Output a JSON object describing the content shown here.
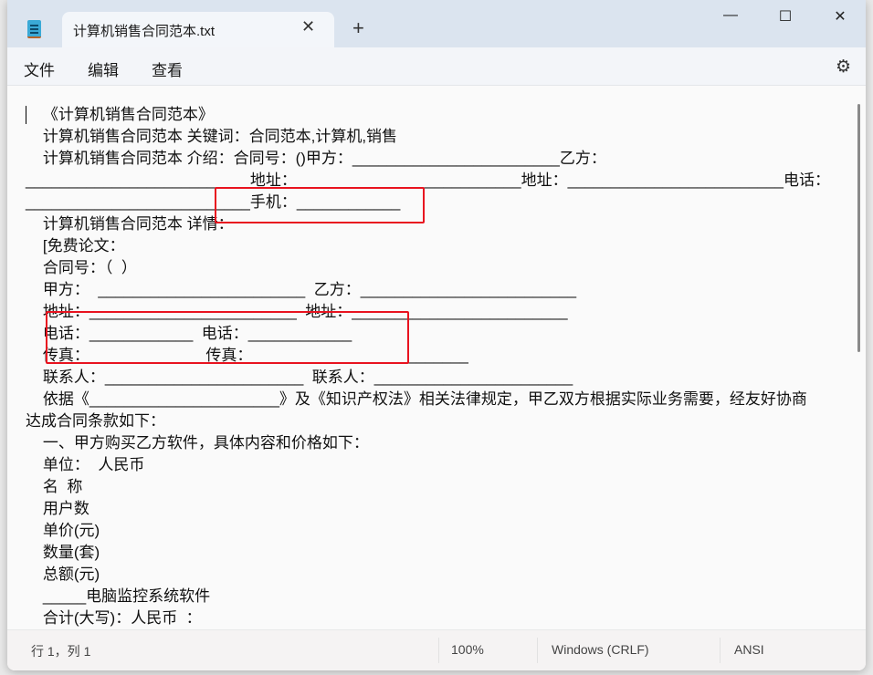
{
  "window": {
    "tab_title": "计算机销售合同范本.txt",
    "tab_close": "✕",
    "new_tab": "+",
    "minimize": "—",
    "maximize": "☐",
    "close": "✕"
  },
  "menu": {
    "items": [
      "文件",
      "编辑",
      "查看"
    ],
    "settings_icon": "⚙"
  },
  "editor": {
    "lines": [
      "    《计算机销售合同范本》",
      "    计算机销售合同范本 关键词：合同范本,计算机,销售",
      "    计算机销售合同范本 介绍：合同号：()甲方：________________________乙方：",
      "__________________________地址：__________________________地址：_________________________电话：",
      "__________________________手机：____________",
      "    计算机销售合同范本 详情：",
      "    [免费论文：",
      "    合同号：（  ）",
      "    甲方：  ________________________  乙方：_________________________",
      "    地址：________________________  地址：_________________________",
      "    电话：____________  电话：____________",
      "    传真：                           传真：_________________________",
      "    联系人：_______________________  联系人：_______________________",
      "    依据《______________________》及《知识产权法》相关法律规定，甲乙双方根据实际业务需要，经友好协商",
      "达成合同条款如下：",
      "    一、甲方购买乙方软件，具体内容和价格如下：",
      "    单位：  人民币",
      "    名  称",
      "    用户数",
      "    单价(元)",
      "    数量(套)",
      "    总额(元)",
      "    _____电脑监控系统软件",
      "    合计(大写)：人民币  ："
    ]
  },
  "status": {
    "position": "行 1，列 1",
    "zoom": "100%",
    "line_ending": "Windows (CRLF)",
    "encoding": "ANSI"
  },
  "colors": {
    "highlight_box": "#e8131f"
  }
}
